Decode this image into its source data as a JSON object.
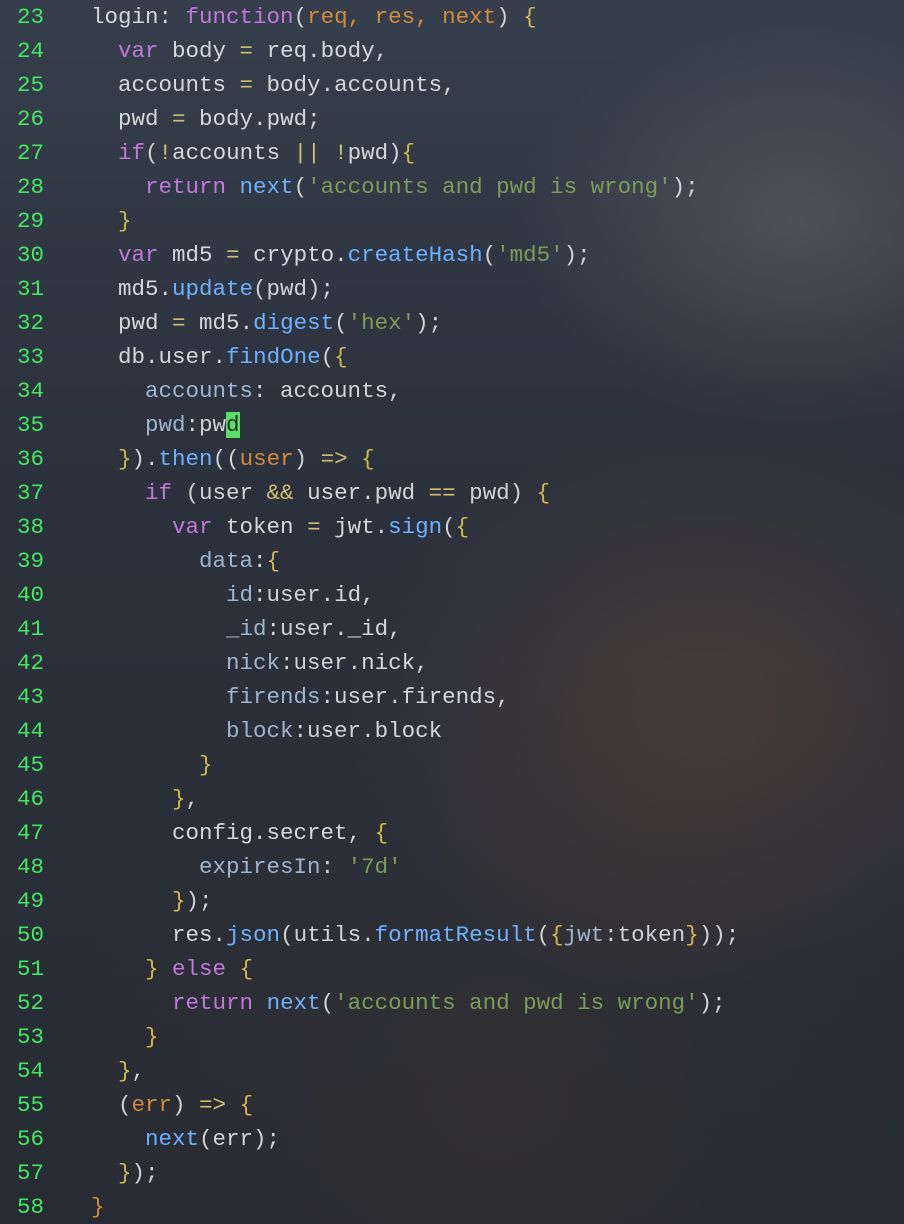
{
  "gutter": {
    "start": 23,
    "end": 58
  },
  "cursor": {
    "line": 35,
    "col_text": "d"
  },
  "code_lines": {
    "23": [
      {
        "t": "  login",
        "c": "id"
      },
      {
        "t": ": ",
        "c": "p"
      },
      {
        "t": "function",
        "c": "kw"
      },
      {
        "t": "(",
        "c": "p"
      },
      {
        "t": "req, res, next",
        "c": "arg"
      },
      {
        "t": ") ",
        "c": "p"
      },
      {
        "t": "{",
        "c": "brY"
      }
    ],
    "24": [
      {
        "t": "    ",
        "c": "p"
      },
      {
        "t": "var",
        "c": "kw"
      },
      {
        "t": " body ",
        "c": "id"
      },
      {
        "t": "=",
        "c": "op"
      },
      {
        "t": " req",
        "c": "id"
      },
      {
        "t": ".",
        "c": "p"
      },
      {
        "t": "body",
        "c": "id"
      },
      {
        "t": ",",
        "c": "p"
      }
    ],
    "25": [
      {
        "t": "    accounts ",
        "c": "id"
      },
      {
        "t": "=",
        "c": "op"
      },
      {
        "t": " body",
        "c": "id"
      },
      {
        "t": ".",
        "c": "p"
      },
      {
        "t": "accounts",
        "c": "id"
      },
      {
        "t": ",",
        "c": "p"
      }
    ],
    "26": [
      {
        "t": "    pwd ",
        "c": "id"
      },
      {
        "t": "=",
        "c": "op"
      },
      {
        "t": " body",
        "c": "id"
      },
      {
        "t": ".",
        "c": "p"
      },
      {
        "t": "pwd",
        "c": "id"
      },
      {
        "t": ";",
        "c": "p"
      }
    ],
    "27": [
      {
        "t": "    ",
        "c": "p"
      },
      {
        "t": "if",
        "c": "kw"
      },
      {
        "t": "(",
        "c": "p"
      },
      {
        "t": "!",
        "c": "op"
      },
      {
        "t": "accounts ",
        "c": "id"
      },
      {
        "t": "||",
        "c": "op"
      },
      {
        "t": " ",
        "c": "p"
      },
      {
        "t": "!",
        "c": "op"
      },
      {
        "t": "pwd",
        "c": "id"
      },
      {
        "t": ")",
        "c": "p"
      },
      {
        "t": "{",
        "c": "brY"
      }
    ],
    "28": [
      {
        "t": "      ",
        "c": "p"
      },
      {
        "t": "return",
        "c": "kw"
      },
      {
        "t": " ",
        "c": "p"
      },
      {
        "t": "next",
        "c": "fn"
      },
      {
        "t": "(",
        "c": "p"
      },
      {
        "t": "'accounts and pwd is wrong'",
        "c": "str"
      },
      {
        "t": ");",
        "c": "p"
      }
    ],
    "29": [
      {
        "t": "    ",
        "c": "p"
      },
      {
        "t": "}",
        "c": "brY"
      }
    ],
    "30": [
      {
        "t": "    ",
        "c": "p"
      },
      {
        "t": "var",
        "c": "kw"
      },
      {
        "t": " md5 ",
        "c": "id"
      },
      {
        "t": "=",
        "c": "op"
      },
      {
        "t": " crypto",
        "c": "id"
      },
      {
        "t": ".",
        "c": "p"
      },
      {
        "t": "createHash",
        "c": "fn"
      },
      {
        "t": "(",
        "c": "p"
      },
      {
        "t": "'md5'",
        "c": "str"
      },
      {
        "t": ");",
        "c": "p"
      }
    ],
    "31": [
      {
        "t": "    md5",
        "c": "id"
      },
      {
        "t": ".",
        "c": "p"
      },
      {
        "t": "update",
        "c": "fn"
      },
      {
        "t": "(pwd);",
        "c": "p"
      }
    ],
    "32": [
      {
        "t": "    pwd ",
        "c": "id"
      },
      {
        "t": "=",
        "c": "op"
      },
      {
        "t": " md5",
        "c": "id"
      },
      {
        "t": ".",
        "c": "p"
      },
      {
        "t": "digest",
        "c": "fn"
      },
      {
        "t": "(",
        "c": "p"
      },
      {
        "t": "'hex'",
        "c": "str"
      },
      {
        "t": ");",
        "c": "p"
      }
    ],
    "33": [
      {
        "t": "    db",
        "c": "id"
      },
      {
        "t": ".",
        "c": "p"
      },
      {
        "t": "user",
        "c": "id"
      },
      {
        "t": ".",
        "c": "p"
      },
      {
        "t": "findOne",
        "c": "fn"
      },
      {
        "t": "(",
        "c": "p"
      },
      {
        "t": "{",
        "c": "brY"
      }
    ],
    "34": [
      {
        "t": "      ",
        "c": "p"
      },
      {
        "t": "accounts",
        "c": "prop"
      },
      {
        "t": ": accounts,",
        "c": "p"
      }
    ],
    "35": [
      {
        "t": "      ",
        "c": "p"
      },
      {
        "t": "pwd",
        "c": "prop"
      },
      {
        "t": ":pw",
        "c": "p"
      },
      {
        "t": "d",
        "c": "cursor"
      }
    ],
    "36": [
      {
        "t": "    ",
        "c": "p"
      },
      {
        "t": "}",
        "c": "brY"
      },
      {
        "t": ").",
        "c": "p"
      },
      {
        "t": "then",
        "c": "fn"
      },
      {
        "t": "((",
        "c": "p"
      },
      {
        "t": "user",
        "c": "arg"
      },
      {
        "t": ") ",
        "c": "p"
      },
      {
        "t": "=>",
        "c": "op"
      },
      {
        "t": " ",
        "c": "p"
      },
      {
        "t": "{",
        "c": "brY"
      }
    ],
    "37": [
      {
        "t": "      ",
        "c": "p"
      },
      {
        "t": "if",
        "c": "kw"
      },
      {
        "t": " (user ",
        "c": "p"
      },
      {
        "t": "&&",
        "c": "op"
      },
      {
        "t": " user",
        "c": "id"
      },
      {
        "t": ".",
        "c": "p"
      },
      {
        "t": "pwd ",
        "c": "id"
      },
      {
        "t": "==",
        "c": "op"
      },
      {
        "t": " pwd) ",
        "c": "p"
      },
      {
        "t": "{",
        "c": "brY"
      }
    ],
    "38": [
      {
        "t": "        ",
        "c": "p"
      },
      {
        "t": "var",
        "c": "kw"
      },
      {
        "t": " token ",
        "c": "id"
      },
      {
        "t": "=",
        "c": "op"
      },
      {
        "t": " jwt",
        "c": "id"
      },
      {
        "t": ".",
        "c": "p"
      },
      {
        "t": "sign",
        "c": "fn"
      },
      {
        "t": "(",
        "c": "p"
      },
      {
        "t": "{",
        "c": "brY"
      }
    ],
    "39": [
      {
        "t": "          ",
        "c": "p"
      },
      {
        "t": "data",
        "c": "prop"
      },
      {
        "t": ":",
        "c": "p"
      },
      {
        "t": "{",
        "c": "brY"
      }
    ],
    "40": [
      {
        "t": "            ",
        "c": "p"
      },
      {
        "t": "id",
        "c": "prop"
      },
      {
        "t": ":user",
        "c": "p"
      },
      {
        "t": ".",
        "c": "p"
      },
      {
        "t": "id",
        "c": "id"
      },
      {
        "t": ",",
        "c": "p"
      }
    ],
    "41": [
      {
        "t": "            ",
        "c": "p"
      },
      {
        "t": "_id",
        "c": "prop"
      },
      {
        "t": ":user",
        "c": "p"
      },
      {
        "t": ".",
        "c": "p"
      },
      {
        "t": "_id",
        "c": "id"
      },
      {
        "t": ",",
        "c": "p"
      }
    ],
    "42": [
      {
        "t": "            ",
        "c": "p"
      },
      {
        "t": "nick",
        "c": "prop"
      },
      {
        "t": ":user",
        "c": "p"
      },
      {
        "t": ".",
        "c": "p"
      },
      {
        "t": "nick",
        "c": "id"
      },
      {
        "t": ",",
        "c": "p"
      }
    ],
    "43": [
      {
        "t": "            ",
        "c": "p"
      },
      {
        "t": "firends",
        "c": "prop"
      },
      {
        "t": ":user",
        "c": "p"
      },
      {
        "t": ".",
        "c": "p"
      },
      {
        "t": "firends",
        "c": "id"
      },
      {
        "t": ",",
        "c": "p"
      }
    ],
    "44": [
      {
        "t": "            ",
        "c": "p"
      },
      {
        "t": "block",
        "c": "prop"
      },
      {
        "t": ":user",
        "c": "p"
      },
      {
        "t": ".",
        "c": "p"
      },
      {
        "t": "block",
        "c": "id"
      }
    ],
    "45": [
      {
        "t": "          ",
        "c": "p"
      },
      {
        "t": "}",
        "c": "brY"
      }
    ],
    "46": [
      {
        "t": "        ",
        "c": "p"
      },
      {
        "t": "}",
        "c": "brY"
      },
      {
        "t": ",",
        "c": "p"
      }
    ],
    "47": [
      {
        "t": "        config",
        "c": "id"
      },
      {
        "t": ".",
        "c": "p"
      },
      {
        "t": "secret",
        "c": "id"
      },
      {
        "t": ", ",
        "c": "p"
      },
      {
        "t": "{",
        "c": "brY"
      }
    ],
    "48": [
      {
        "t": "          ",
        "c": "p"
      },
      {
        "t": "expiresIn",
        "c": "prop"
      },
      {
        "t": ": ",
        "c": "p"
      },
      {
        "t": "'7d'",
        "c": "str"
      }
    ],
    "49": [
      {
        "t": "        ",
        "c": "p"
      },
      {
        "t": "}",
        "c": "brY"
      },
      {
        "t": ");",
        "c": "p"
      }
    ],
    "50": [
      {
        "t": "        res",
        "c": "id"
      },
      {
        "t": ".",
        "c": "p"
      },
      {
        "t": "json",
        "c": "fn"
      },
      {
        "t": "(utils",
        "c": "p"
      },
      {
        "t": ".",
        "c": "p"
      },
      {
        "t": "formatResult",
        "c": "fn"
      },
      {
        "t": "(",
        "c": "p"
      },
      {
        "t": "{",
        "c": "brY"
      },
      {
        "t": "jwt",
        "c": "prop"
      },
      {
        "t": ":token",
        "c": "p"
      },
      {
        "t": "}",
        "c": "brY"
      },
      {
        "t": "));",
        "c": "p"
      }
    ],
    "51": [
      {
        "t": "      ",
        "c": "p"
      },
      {
        "t": "}",
        "c": "brY"
      },
      {
        "t": " ",
        "c": "p"
      },
      {
        "t": "else",
        "c": "kw"
      },
      {
        "t": " ",
        "c": "p"
      },
      {
        "t": "{",
        "c": "brY"
      }
    ],
    "52": [
      {
        "t": "        ",
        "c": "p"
      },
      {
        "t": "return",
        "c": "kw"
      },
      {
        "t": " ",
        "c": "p"
      },
      {
        "t": "next",
        "c": "fn"
      },
      {
        "t": "(",
        "c": "p"
      },
      {
        "t": "'accounts and pwd is wrong'",
        "c": "str"
      },
      {
        "t": ");",
        "c": "p"
      }
    ],
    "53": [
      {
        "t": "      ",
        "c": "p"
      },
      {
        "t": "}",
        "c": "brY"
      }
    ],
    "54": [
      {
        "t": "    ",
        "c": "p"
      },
      {
        "t": "}",
        "c": "brY"
      },
      {
        "t": ",",
        "c": "p"
      }
    ],
    "55": [
      {
        "t": "    (",
        "c": "p"
      },
      {
        "t": "err",
        "c": "arg"
      },
      {
        "t": ") ",
        "c": "p"
      },
      {
        "t": "=>",
        "c": "op"
      },
      {
        "t": " ",
        "c": "p"
      },
      {
        "t": "{",
        "c": "brY"
      }
    ],
    "56": [
      {
        "t": "      ",
        "c": "p"
      },
      {
        "t": "next",
        "c": "fn"
      },
      {
        "t": "(err);",
        "c": "p"
      }
    ],
    "57": [
      {
        "t": "    ",
        "c": "p"
      },
      {
        "t": "}",
        "c": "brY"
      },
      {
        "t": ");",
        "c": "p"
      }
    ],
    "58": [
      {
        "t": "  ",
        "c": "p"
      },
      {
        "t": "}",
        "c": "brO"
      }
    ]
  }
}
